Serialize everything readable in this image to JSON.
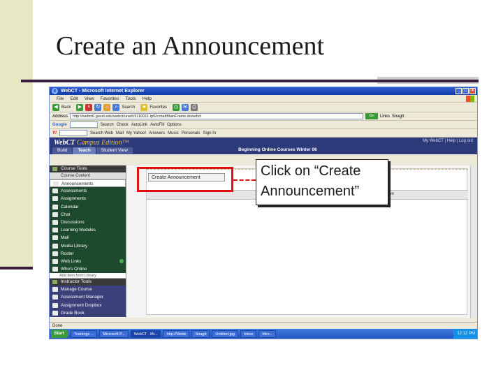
{
  "slide": {
    "title": "Create an Announcement",
    "callout_text": "Click on “Create Announcement”"
  },
  "browser": {
    "window_title": "WebCT - Microsoft Internet Explorer",
    "menu": [
      "File",
      "Edit",
      "View",
      "Favorites",
      "Tools",
      "Help"
    ],
    "toolbar": [
      "Back",
      "Search",
      "Favorites"
    ],
    "address_label": "Address",
    "address_value": "http://webct6.govst.edu/webct/urw/lc5116011.tp0/cobaltMainFrame.dowebct",
    "go_label": "Go",
    "links_label": "Links",
    "snagit_label": "SnagIt",
    "google_label": "Google",
    "google_search": "Search",
    "yahoo_label": "Y!",
    "yahoo_items": [
      "Search Web",
      "Mail",
      "My Yahoo!",
      "Answers",
      "Music",
      "Personals",
      "Sign In"
    ],
    "google_items": [
      "Check",
      "AutoLink",
      "AutoFill",
      "Options"
    ],
    "status_text": "Done",
    "taskbar": {
      "start": "Start",
      "items": [
        "Trainings ...",
        "Microsoft P...",
        "WebCT - Mi...",
        "http://Webb",
        "SnagIt",
        "Untitled.jpg",
        "Inbox",
        "Micr..."
      ],
      "clock": "12:12 PM"
    }
  },
  "webct": {
    "logo": "WebCT",
    "edition": "Campus Edition™",
    "tabs": [
      "Build",
      "Teach",
      "Student View"
    ],
    "user_links": "My WebCT | Help | Log out",
    "courses_title": "Beginning Online Courses Winter 06",
    "sidebar": {
      "course_tools_header": "Course Tools",
      "course_content": "Course Content",
      "tools": [
        "Announcements",
        "Assessments",
        "Assignments",
        "Calendar",
        "Chat",
        "Discussions",
        "Learning Modules",
        "Mail",
        "Media Library",
        "Roster",
        "Web Links",
        "Who's Online"
      ],
      "add_from_library": "Add Item from Library",
      "instructor_tools_header": "Instructor Tools",
      "instructor_tools": [
        "Manage Course",
        "Assessment Manager",
        "Assignment Dropbox",
        "Grade Book"
      ]
    },
    "content": {
      "create_button": "Create Announcement",
      "strip_label": "Remove"
    }
  }
}
